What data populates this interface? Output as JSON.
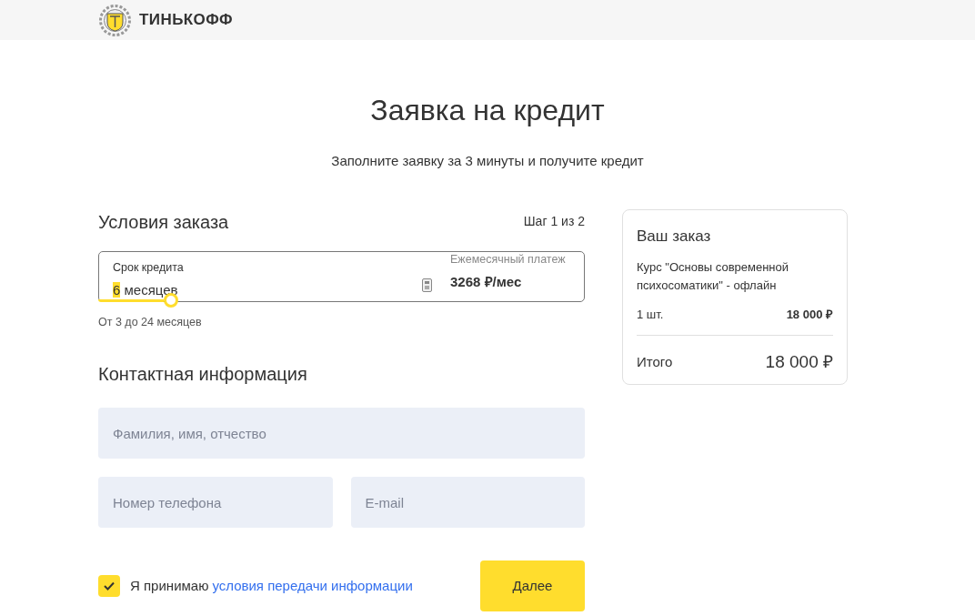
{
  "header": {
    "brand": "ТИНЬКОФФ"
  },
  "page": {
    "title": "Заявка на кредит",
    "subtitle": "Заполните заявку за 3 минуты и получите кредит"
  },
  "order_conditions": {
    "heading": "Условия заказа",
    "step": "Шаг 1 из 2",
    "term": {
      "label": "Срок кредита",
      "value_number": "6",
      "value_unit": "месяцев",
      "level": 0.15,
      "hint": "От 3 до 24 месяцев"
    },
    "payment": {
      "label": "Ежемесячный платеж",
      "value": "3268 ₽/мес"
    }
  },
  "contact": {
    "heading": "Контактная информация",
    "fields": [
      {
        "placeholder": "Фамилия, имя, отчество"
      },
      {
        "placeholder": "Номер телефона"
      },
      {
        "placeholder": "E-mail"
      }
    ]
  },
  "consent": {
    "checked": true,
    "text": "Я принимаю",
    "link": "условия передачи информации"
  },
  "next_button": "Далее",
  "summary": {
    "title": "Ваш заказ",
    "product": "Курс \"Основы современной психосоматики\" - офлайн",
    "quantity": "1 шт.",
    "price": "18 000 ₽",
    "total_label": "Итого",
    "total": "18 000 ₽"
  }
}
